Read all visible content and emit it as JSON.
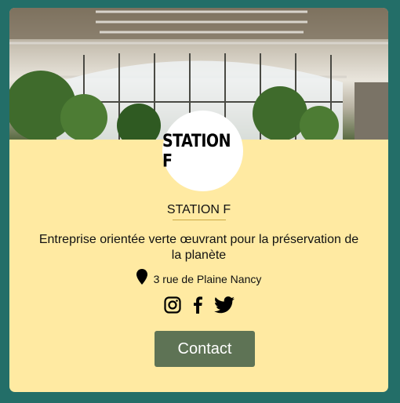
{
  "company": {
    "logo_text": "STATION F",
    "name": "STATION F",
    "description": "Entreprise orientée verte œuvrant pour la préservation de la planète",
    "address": "3 rue de Plaine Nancy"
  },
  "social": [
    "instagram-icon",
    "facebook-icon",
    "twitter-icon"
  ],
  "contact_label": "Contact",
  "colors": {
    "page_background": "#236e68",
    "card_background": "#ffeaa2",
    "button_background": "#5e7355",
    "button_text": "#ffffff"
  }
}
